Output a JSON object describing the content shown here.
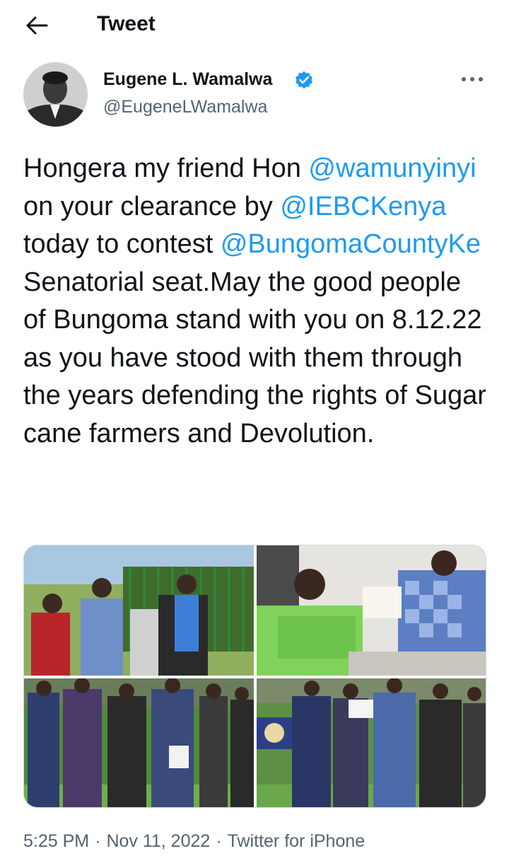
{
  "header": {
    "title": "Tweet",
    "back_icon": "back-arrow-icon"
  },
  "author": {
    "name": "Eugene L. Wamalwa",
    "handle": "@EugeneLWamalwa",
    "verified_icon": "verified-badge-icon",
    "more_icon": "more-options-icon"
  },
  "tweet": {
    "segments": [
      {
        "text": "Hongera my friend Hon ",
        "type": "text"
      },
      {
        "text": "@wamunyinyi",
        "type": "mention"
      },
      {
        "text": " on your clearance by ",
        "type": "text"
      },
      {
        "text": "@IEBCKenya",
        "type": "mention"
      },
      {
        "text": " today to contest ",
        "type": "text"
      },
      {
        "text": "@BungomaCountyKe",
        "type": "mention"
      },
      {
        "text": " Senatorial seat.May the good people of Bungoma stand with you on 8.12.22 as you have stood with them through the years defending the rights of Sugar cane farmers and Devolution.",
        "type": "text"
      }
    ]
  },
  "media": {
    "photo_count": 4
  },
  "meta": {
    "time": "5:25 PM",
    "separator": "·",
    "date": "Nov 11, 2022",
    "source": "Twitter for iPhone"
  },
  "colors": {
    "accent": "#1d9bf0",
    "text": "#0f1419",
    "secondary": "#536471"
  }
}
